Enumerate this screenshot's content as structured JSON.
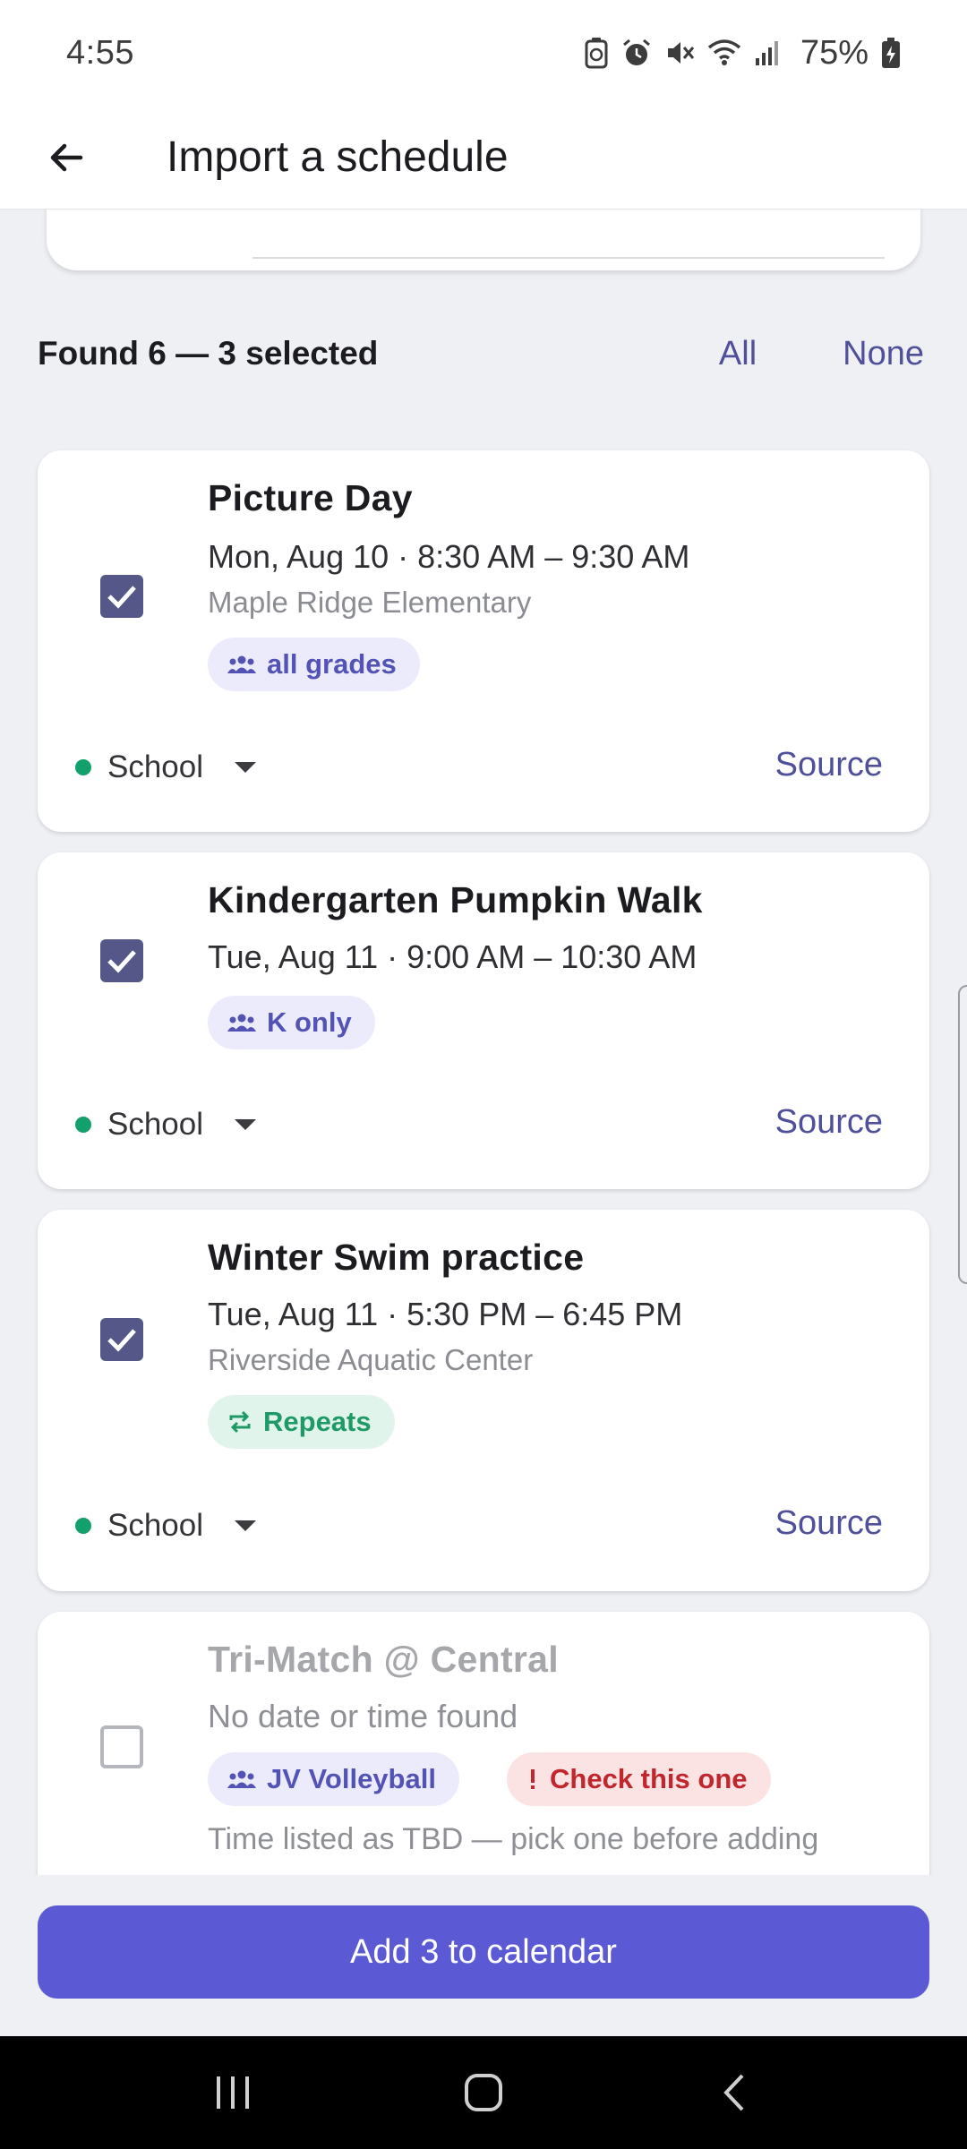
{
  "status_bar": {
    "time": "4:55",
    "battery": "75%",
    "icons": [
      "battery-saver-icon",
      "alarm-icon",
      "mute-icon",
      "wifi-icon",
      "signal-icon",
      "battery-charging-icon"
    ]
  },
  "app_bar": {
    "title": "Import a schedule",
    "back_icon": "arrow-left-icon"
  },
  "summary": {
    "found_text": "Found 6 — 3 selected",
    "all_label": "All",
    "none_label": "None"
  },
  "events": [
    {
      "title": "Picture Day",
      "datetime": "Mon, Aug 10 · 8:30 AM – 9:30 AM",
      "location": "Maple Ridge Elementary",
      "checked": true,
      "chips": [
        {
          "label": "all grades",
          "icon": "group-icon",
          "color": "#5353b5"
        }
      ],
      "category": "School",
      "category_color": "#12a06d",
      "source_label": "Source"
    },
    {
      "title": "Kindergarten Pumpkin Walk",
      "datetime": "Tue, Aug 11 · 9:00 AM – 10:30 AM",
      "checked": true,
      "chips": [
        {
          "label": "K only",
          "icon": "group-icon",
          "color": "#5353b5"
        }
      ],
      "category": "School",
      "category_color": "#12a06d",
      "source_label": "Source"
    },
    {
      "title": "Winter Swim practice",
      "datetime": "Tue, Aug 11 · 5:30 PM – 6:45 PM",
      "location": "Riverside Aquatic Center",
      "checked": true,
      "chips": [
        {
          "label": "Repeats",
          "icon": "repeat-icon",
          "color": "#1f9a67"
        }
      ],
      "category": "School",
      "category_color": "#12a06d",
      "source_label": "Source"
    },
    {
      "title": "Tri-Match @ Central",
      "datetime": "No date or time found",
      "checked": false,
      "chips": [
        {
          "label": "JV Volleyball",
          "icon": "group-icon",
          "color": "#5353b5"
        },
        {
          "label": "Check this one",
          "icon": "exclamation-icon",
          "color": "#c0272d"
        }
      ],
      "note": "Time listed as TBD — pick one before adding"
    }
  ],
  "primary_action": {
    "label": "Add 3 to calendar",
    "color": "#5b59d4"
  },
  "nav_bar": {
    "icons": [
      "recents-icon",
      "home-icon",
      "back-icon"
    ]
  }
}
